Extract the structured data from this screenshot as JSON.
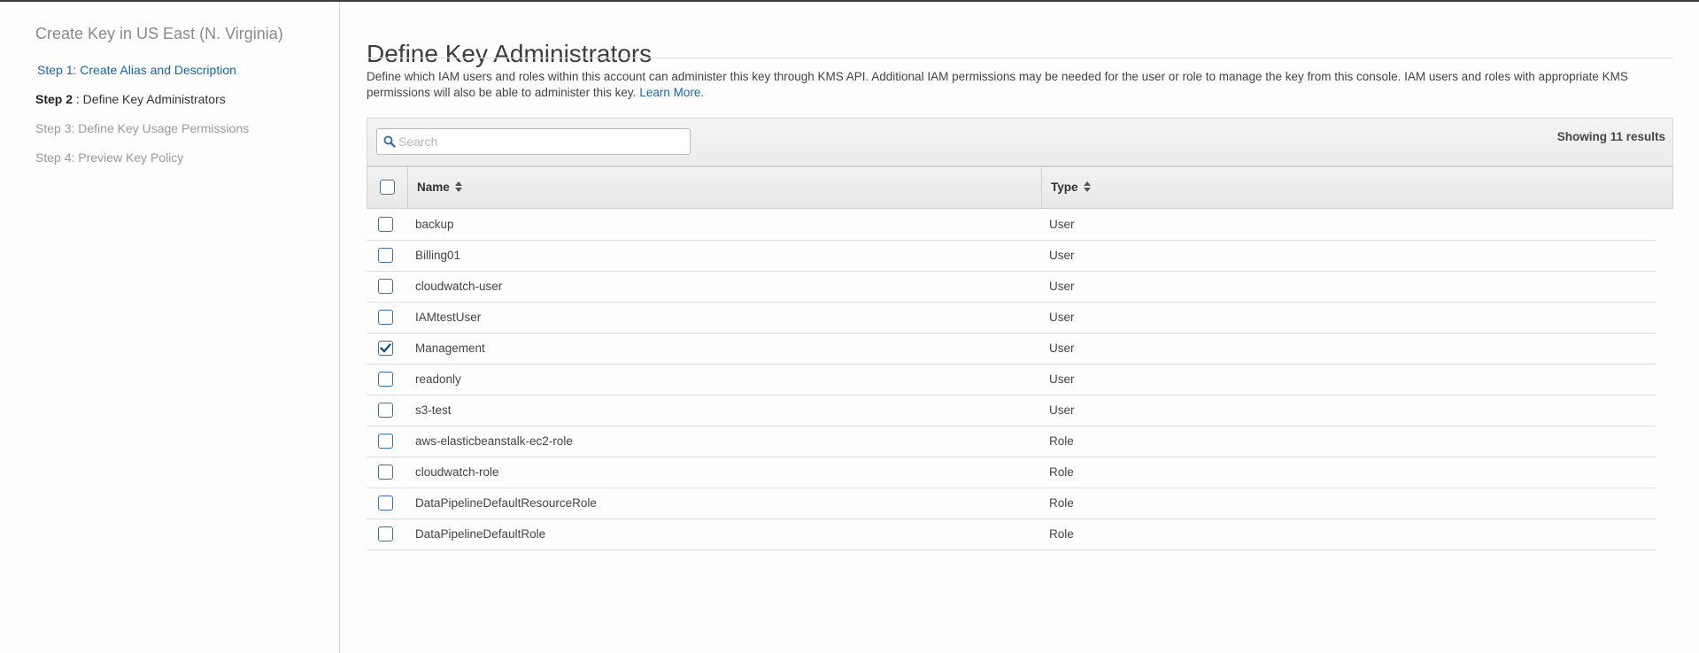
{
  "sidebar": {
    "title": "Create Key in US East (N. Virginia)",
    "steps": [
      {
        "label": "Step 1: Create Alias and Description"
      },
      {
        "bold": "Step 2",
        "label": " : Define Key Administrators"
      },
      {
        "label": "Step 3: Define Key Usage Permissions"
      },
      {
        "label": "Step 4: Preview Key Policy"
      }
    ]
  },
  "main": {
    "title": "Define Key Administrators",
    "description": "Define which IAM users and roles within this account can administer this key through KMS API. Additional IAM permissions may be needed for the user or role to manage the key from this console. IAM users and roles with appropriate KMS permissions will also be able to administer this key.",
    "learn_more": "Learn More."
  },
  "search": {
    "placeholder": "Search",
    "value": ""
  },
  "results": {
    "text": "Showing 11 results"
  },
  "table": {
    "columns": {
      "name": "Name",
      "type": "Type"
    },
    "rows": [
      {
        "name": "backup",
        "type": "User",
        "checked": false
      },
      {
        "name": "Billing01",
        "type": "User",
        "checked": false
      },
      {
        "name": "cloudwatch-user",
        "type": "User",
        "checked": false
      },
      {
        "name": "IAMtestUser",
        "type": "User",
        "checked": false
      },
      {
        "name": "Management",
        "type": "User",
        "checked": true
      },
      {
        "name": "readonly",
        "type": "User",
        "checked": false
      },
      {
        "name": "s3-test",
        "type": "User",
        "checked": false
      },
      {
        "name": "aws-elasticbeanstalk-ec2-role",
        "type": "Role",
        "checked": false
      },
      {
        "name": "cloudwatch-role",
        "type": "Role",
        "checked": false
      },
      {
        "name": "DataPipelineDefaultResourceRole",
        "type": "Role",
        "checked": false
      },
      {
        "name": "DataPipelineDefaultRole",
        "type": "Role",
        "checked": false
      }
    ]
  },
  "icons": {
    "search": "magnifier-icon",
    "sort": "sort-updown-icon",
    "check": "checkmark-icon"
  },
  "colors": {
    "link": "#1a63b0",
    "checkbox_border": "#3a6fb5",
    "check": "#1a4f8f"
  }
}
